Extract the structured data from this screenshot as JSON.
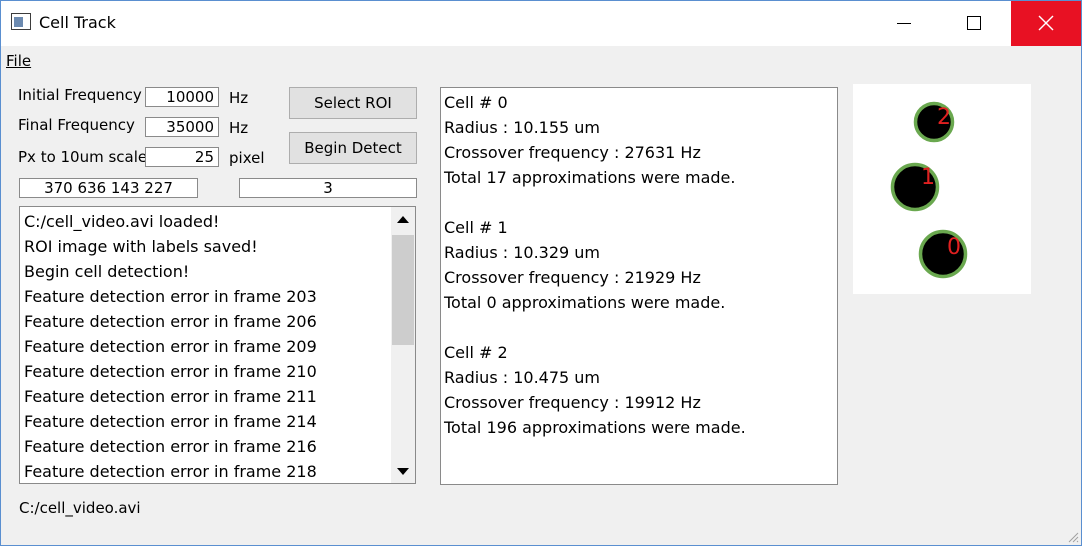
{
  "window": {
    "title": "Cell Track",
    "close_color": "#e81123"
  },
  "menu": {
    "file": "File"
  },
  "form": {
    "initial_frequency_label": "Initial Frequency",
    "initial_frequency_value": "10000",
    "initial_frequency_unit": "Hz",
    "final_frequency_label": "Final Frequency",
    "final_frequency_value": "35000",
    "final_frequency_unit": "Hz",
    "scale_label": "Px to 10um scale",
    "scale_value": "25",
    "scale_unit": "pixel",
    "roi_coords": "370 636 143 227",
    "cell_count": "3"
  },
  "buttons": {
    "select_roi": "Select ROI",
    "begin_detect": "Begin Detect"
  },
  "log": {
    "items": [
      "C:/cell_video.avi loaded!",
      "ROI image with labels saved!",
      "Begin cell detection!",
      "Feature detection error in frame 203",
      "Feature detection error in frame 206",
      "Feature detection error in frame 209",
      "Feature detection error in frame 210",
      "Feature detection error in frame 211",
      "Feature detection error in frame 214",
      "Feature detection error in frame 216",
      "Feature detection error in frame 218"
    ]
  },
  "results": {
    "lines": [
      "Cell # 0",
      "Radius : 10.155 um",
      "Crossover frequency : 27631 Hz",
      "Total 17 approximations were made.",
      "",
      "Cell # 1",
      "Radius : 10.329 um",
      "Crossover frequency : 21929 Hz",
      "Total 0 approximations were made.",
      "",
      "Cell # 2",
      "Radius : 10.475 um",
      "Crossover frequency : 19912 Hz",
      "Total 196 approximations were made."
    ]
  },
  "roi_image": {
    "cells": [
      {
        "label": "2"
      },
      {
        "label": "1"
      },
      {
        "label": "0"
      }
    ],
    "ring_color": "#6aa84f",
    "label_color": "#e02020"
  },
  "status": {
    "path": "C:/cell_video.avi"
  }
}
